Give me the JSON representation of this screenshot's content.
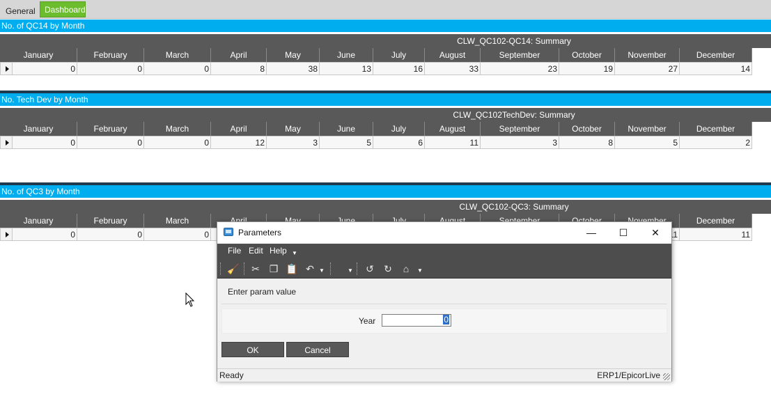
{
  "tabs": [
    {
      "label": "General",
      "active": false
    },
    {
      "label": "Dashboard",
      "active": true
    }
  ],
  "colors": {
    "accent_blue": "#00aeef",
    "active_tab": "#6cbd2e",
    "grid_header": "#595959"
  },
  "months": [
    "January",
    "February",
    "March",
    "April",
    "May",
    "June",
    "July",
    "August",
    "September",
    "October",
    "November",
    "December"
  ],
  "panels": [
    {
      "title": "No. of QC14 by Month",
      "summary": "CLW_QC102-QC14: Summary",
      "values": [
        "0",
        "0",
        "0",
        "8",
        "38",
        "13",
        "16",
        "33",
        "23",
        "19",
        "27",
        "14"
      ]
    },
    {
      "title": "No. Tech Dev by Month",
      "summary": "CLW_QC102TechDev: Summary",
      "values": [
        "0",
        "0",
        "0",
        "12",
        "3",
        "5",
        "6",
        "11",
        "3",
        "8",
        "5",
        "2"
      ]
    },
    {
      "title": "No. of QC3 by Month",
      "summary": "CLW_QC102-QC3: Summary",
      "values": [
        "0",
        "0",
        "0",
        "",
        "",
        "",
        "",
        "",
        "",
        "",
        "11",
        "11"
      ]
    }
  ],
  "dialog": {
    "title": "Parameters",
    "menu": [
      "File",
      "Edit",
      "Help"
    ],
    "toolbar_icons": [
      "clear-icon",
      "cut-icon",
      "copy-icon",
      "paste-icon",
      "undo-icon",
      "back-icon",
      "forward-icon",
      "home-icon"
    ],
    "prompt": "Enter param value",
    "year_label": "Year",
    "year_value": "0",
    "ok_label": "OK",
    "cancel_label": "Cancel",
    "status_left": "Ready",
    "status_right": "ERP1/EpicorLive"
  }
}
